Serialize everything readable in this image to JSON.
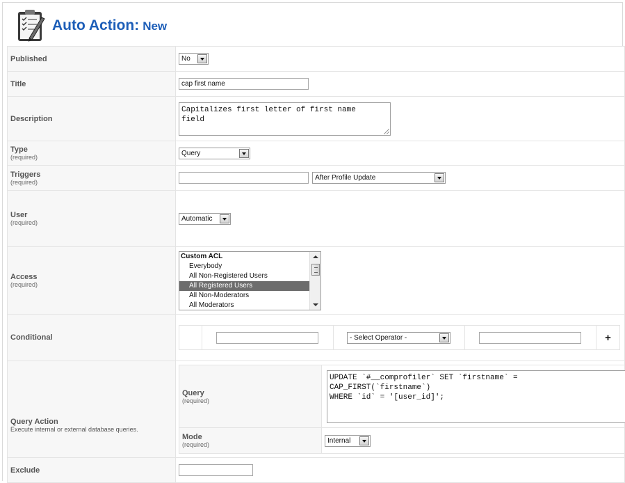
{
  "header": {
    "title_main": "Auto Action:",
    "title_sub": "New"
  },
  "required_text": "(required)",
  "fields": {
    "published": {
      "label": "Published",
      "value": "No"
    },
    "title": {
      "label": "Title",
      "value": "cap first name"
    },
    "description": {
      "label": "Description",
      "value": "Capitalizes first letter of first name\nfield"
    },
    "type": {
      "label": "Type",
      "value": "Query"
    },
    "triggers": {
      "label": "Triggers",
      "input_value": "",
      "select_value": "After Profile Update"
    },
    "user": {
      "label": "User",
      "value": "Automatic"
    },
    "access": {
      "label": "Access",
      "options": [
        "Custom ACL",
        "Everybody",
        "All Non-Registered Users",
        "All Registered Users",
        "All Non-Moderators",
        "All Moderators"
      ],
      "selected": "All Registered Users"
    },
    "conditional": {
      "label": "Conditional",
      "field_value": "",
      "operator": "- Select Operator -",
      "compare_value": "",
      "add_symbol": "+"
    },
    "query_action": {
      "label": "Query Action",
      "help": "Execute internal or external database queries.",
      "query_label": "Query",
      "query_value": "UPDATE `#__comprofiler` SET `firstname` =\nCAP_FIRST(`firstname`)\nWHERE `id` = '[user_id]';",
      "mode_label": "Mode",
      "mode_value": "Internal"
    },
    "exclude": {
      "label": "Exclude",
      "value": ""
    }
  }
}
